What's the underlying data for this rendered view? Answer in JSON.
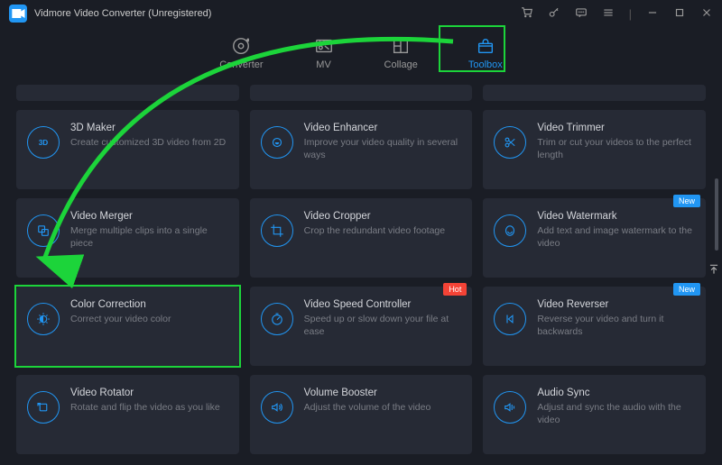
{
  "app": {
    "title": "Vidmore Video Converter (Unregistered)"
  },
  "tabs": [
    {
      "id": "converter",
      "label": "Converter"
    },
    {
      "id": "mv",
      "label": "MV"
    },
    {
      "id": "collage",
      "label": "Collage"
    },
    {
      "id": "toolbox",
      "label": "Toolbox"
    }
  ],
  "badges": {
    "hot": "Hot",
    "new": "New"
  },
  "tools": [
    {
      "icon": "3d",
      "title": "3D Maker",
      "desc": "Create customized 3D video from 2D",
      "badge": null
    },
    {
      "icon": "enhancer",
      "title": "Video Enhancer",
      "desc": "Improve your video quality in several ways",
      "badge": null
    },
    {
      "icon": "trimmer",
      "title": "Video Trimmer",
      "desc": "Trim or cut your videos to the perfect length",
      "badge": null
    },
    {
      "icon": "merger",
      "title": "Video Merger",
      "desc": "Merge multiple clips into a single piece",
      "badge": null
    },
    {
      "icon": "cropper",
      "title": "Video Cropper",
      "desc": "Crop the redundant video footage",
      "badge": null
    },
    {
      "icon": "watermark",
      "title": "Video Watermark",
      "desc": "Add text and image watermark to the video",
      "badge": "new"
    },
    {
      "icon": "color",
      "title": "Color Correction",
      "desc": "Correct your video color",
      "badge": null
    },
    {
      "icon": "speed",
      "title": "Video Speed Controller",
      "desc": "Speed up or slow down your file at ease",
      "badge": "hot"
    },
    {
      "icon": "reverser",
      "title": "Video Reverser",
      "desc": "Reverse your video and turn it backwards",
      "badge": "new"
    },
    {
      "icon": "rotator",
      "title": "Video Rotator",
      "desc": "Rotate and flip the video as you like",
      "badge": null
    },
    {
      "icon": "volume",
      "title": "Volume Booster",
      "desc": "Adjust the volume of the video",
      "badge": null
    },
    {
      "icon": "audiosync",
      "title": "Audio Sync",
      "desc": "Adjust and sync the audio with the video",
      "badge": null
    }
  ]
}
